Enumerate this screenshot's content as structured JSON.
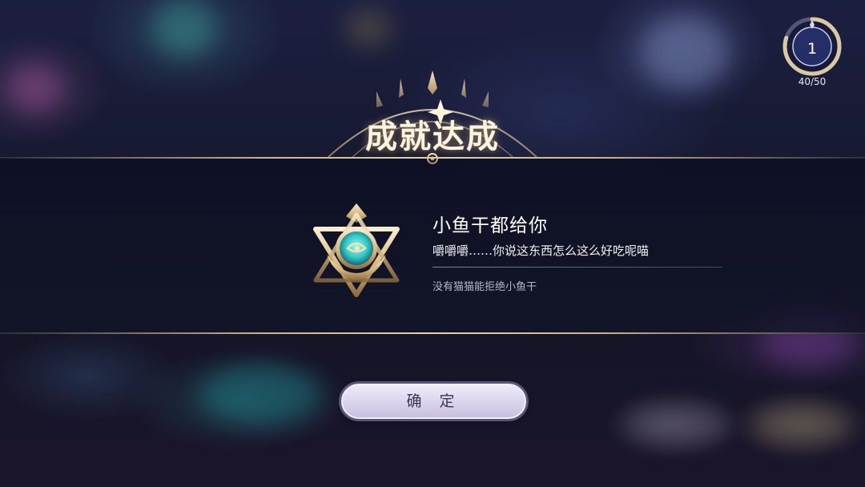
{
  "progress": {
    "level": "1",
    "count": "40/50",
    "fraction": 0.8
  },
  "header": {
    "title": "成就达成"
  },
  "achievement": {
    "name": "小鱼干都给你",
    "description": "嚼嚼嚼……你说这东西怎么这么好吃呢喵",
    "hint": "没有猫猫能拒绝小鱼干"
  },
  "actions": {
    "confirm_label": "确 定"
  },
  "colors": {
    "accent_gold": "#e6cd9f",
    "emblem_teal": "#3fd8d2",
    "button_bg": "#dcd7ee",
    "button_text": "#3a3658"
  }
}
